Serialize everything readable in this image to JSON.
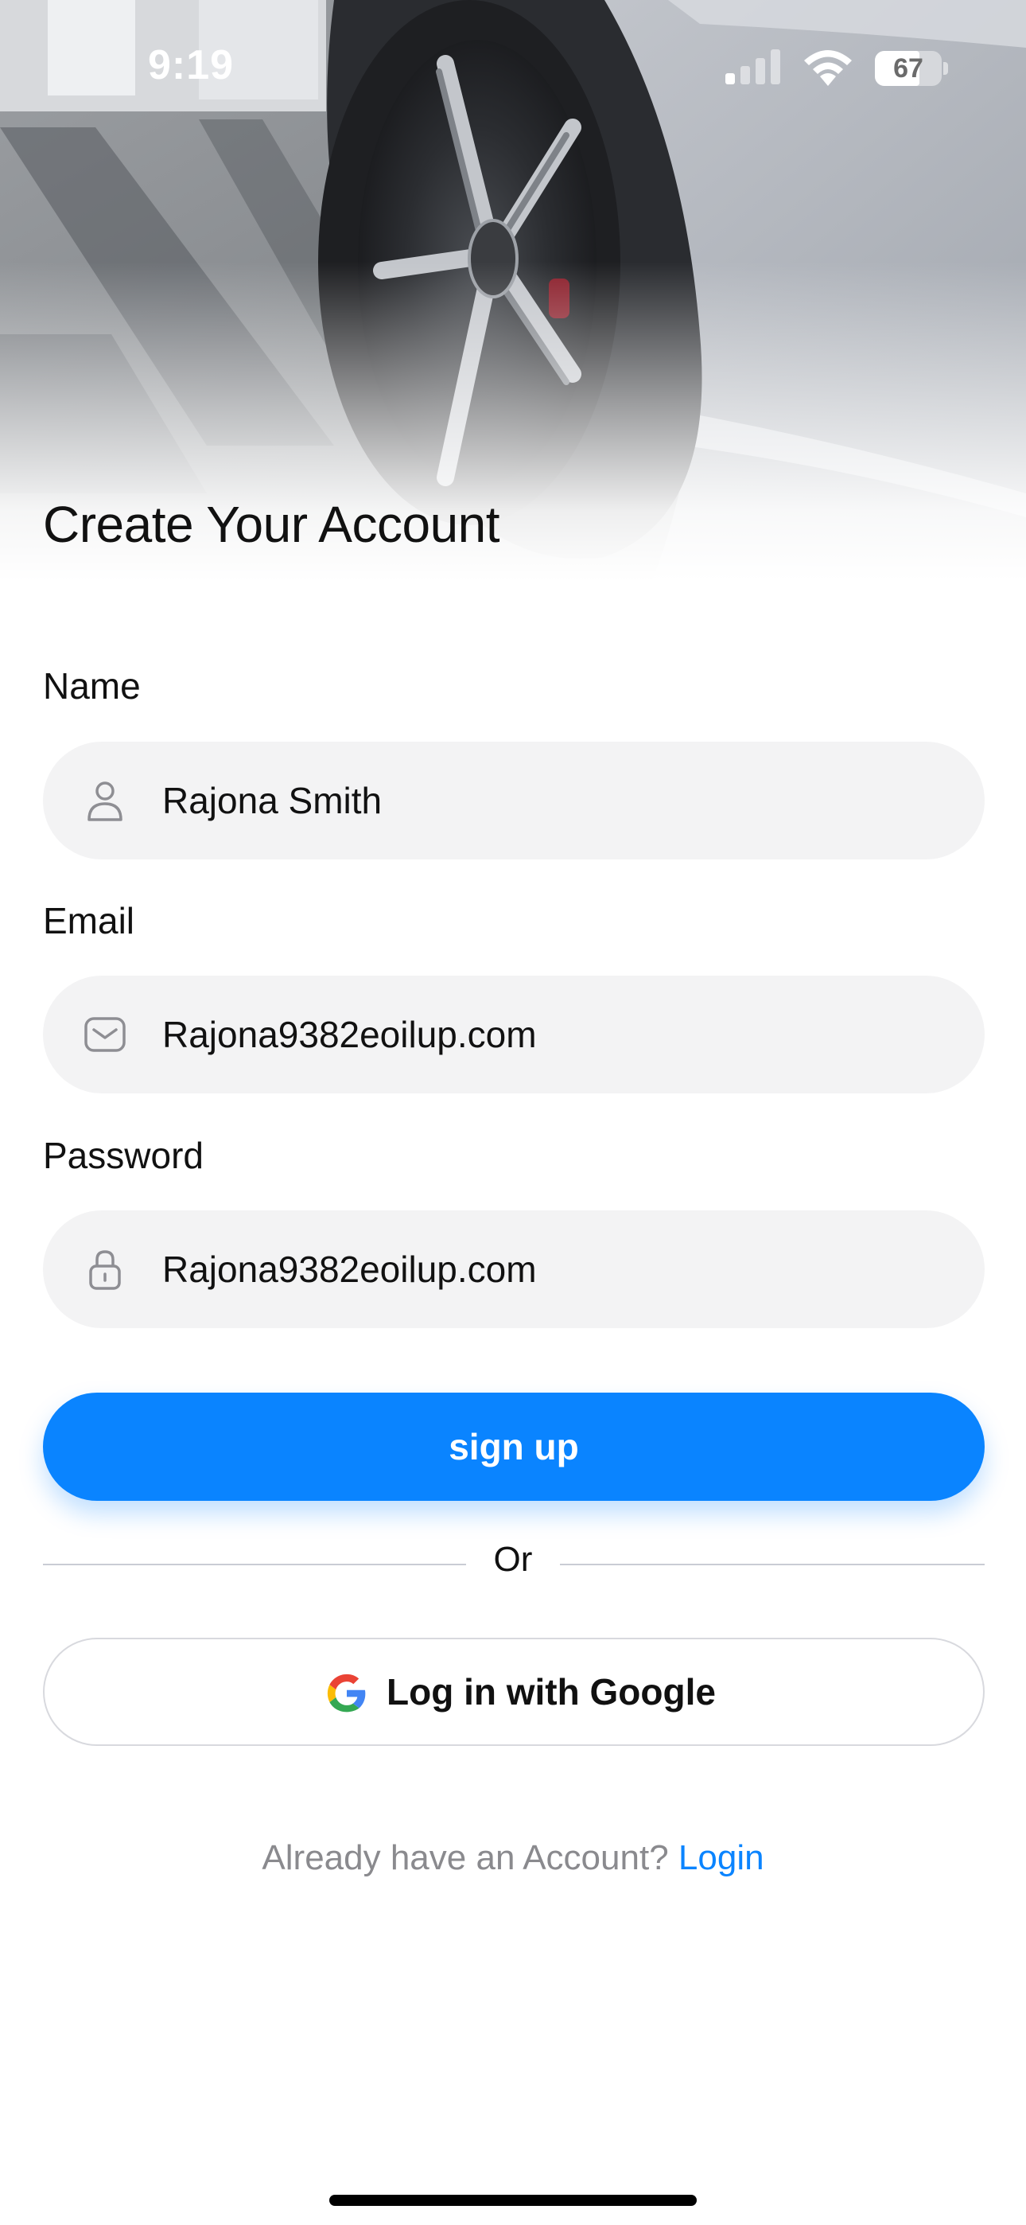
{
  "status_bar": {
    "time": "9:19",
    "battery_percent": "67",
    "battery_level": 0.67,
    "icons": [
      "signal-icon",
      "wifi-icon",
      "battery-icon"
    ]
  },
  "hero": {
    "image": "silver sports car wheel photo"
  },
  "title": "Create Your Account",
  "form": {
    "name": {
      "label": "Name",
      "value": "Rajona Smith",
      "icon": "user-icon"
    },
    "email": {
      "label": "Email",
      "value": "Rajona9382eoilup.com",
      "icon": "mail-icon"
    },
    "password": {
      "label": "Password",
      "value": "Rajona9382eoilup.com",
      "icon": "lock-icon"
    }
  },
  "signup_button": "sign up",
  "divider_text": "Or",
  "google_button": {
    "label": "Log in with Google",
    "icon": "google-icon"
  },
  "footer": {
    "prompt": "Already have an Account?",
    "link": "Login"
  },
  "colors": {
    "accent": "#0a84ff",
    "field_background": "#f3f3f4",
    "text": "#111111",
    "muted": "#8a8a8e"
  }
}
